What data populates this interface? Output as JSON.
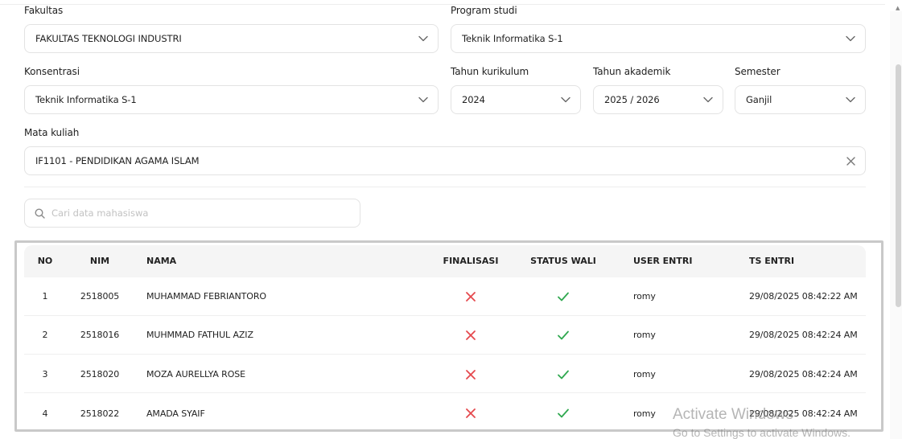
{
  "filters": {
    "fakultas": {
      "label": "Fakultas",
      "value": "FAKULTAS TEKNOLOGI INDUSTRI"
    },
    "program_studi": {
      "label": "Program studi",
      "value": "Teknik Informatika S-1"
    },
    "konsentrasi": {
      "label": "Konsentrasi",
      "value": "Teknik Informatika S-1"
    },
    "tahun_kurikulum": {
      "label": "Tahun kurikulum",
      "value": "2024"
    },
    "tahun_akademik": {
      "label": "Tahun akademik",
      "value": "2025 / 2026"
    },
    "semester": {
      "label": "Semester",
      "value": "Ganjil"
    },
    "mata_kuliah": {
      "label": "Mata kuliah",
      "value": "IF1101 - PENDIDIKAN AGAMA ISLAM"
    }
  },
  "search": {
    "placeholder": "Cari data mahasiswa"
  },
  "table": {
    "columns": {
      "no": "NO",
      "nim": "NIM",
      "nama": "NAMA",
      "finalisasi": "FINALISASI",
      "status_wali": "STATUS WALI",
      "user_entri": "USER ENTRI",
      "ts_entri": "TS ENTRI"
    },
    "rows": [
      {
        "no": "1",
        "nim": "2518005",
        "nama": "MUHAMMAD FEBRIANTORO",
        "finalisasi": "cross-icon",
        "status_wali": "check-icon",
        "user_entri": "romy",
        "ts_entri": "29/08/2025 08:42:22 AM"
      },
      {
        "no": "2",
        "nim": "2518016",
        "nama": "MUHMMAD FATHUL AZIZ",
        "finalisasi": "cross-icon",
        "status_wali": "check-icon",
        "user_entri": "romy",
        "ts_entri": "29/08/2025 08:42:24 AM"
      },
      {
        "no": "3",
        "nim": "2518020",
        "nama": "MOZA AURELLYA ROSE",
        "finalisasi": "cross-icon",
        "status_wali": "check-icon",
        "user_entri": "romy",
        "ts_entri": "29/08/2025 08:42:24 AM"
      },
      {
        "no": "4",
        "nim": "2518022",
        "nama": "AMADA SYAIF",
        "finalisasi": "cross-icon",
        "status_wali": "check-icon",
        "user_entri": "romy",
        "ts_entri": "29/08/2025 08:42:24 AM"
      }
    ]
  },
  "watermark": {
    "line1": "Activate Windows",
    "line2": "Go to Settings to activate Windows."
  },
  "colors": {
    "cross": "#e5484d",
    "check": "#2fa84f",
    "border": "#e3e3e3",
    "header_bg": "#f5f5f5"
  }
}
